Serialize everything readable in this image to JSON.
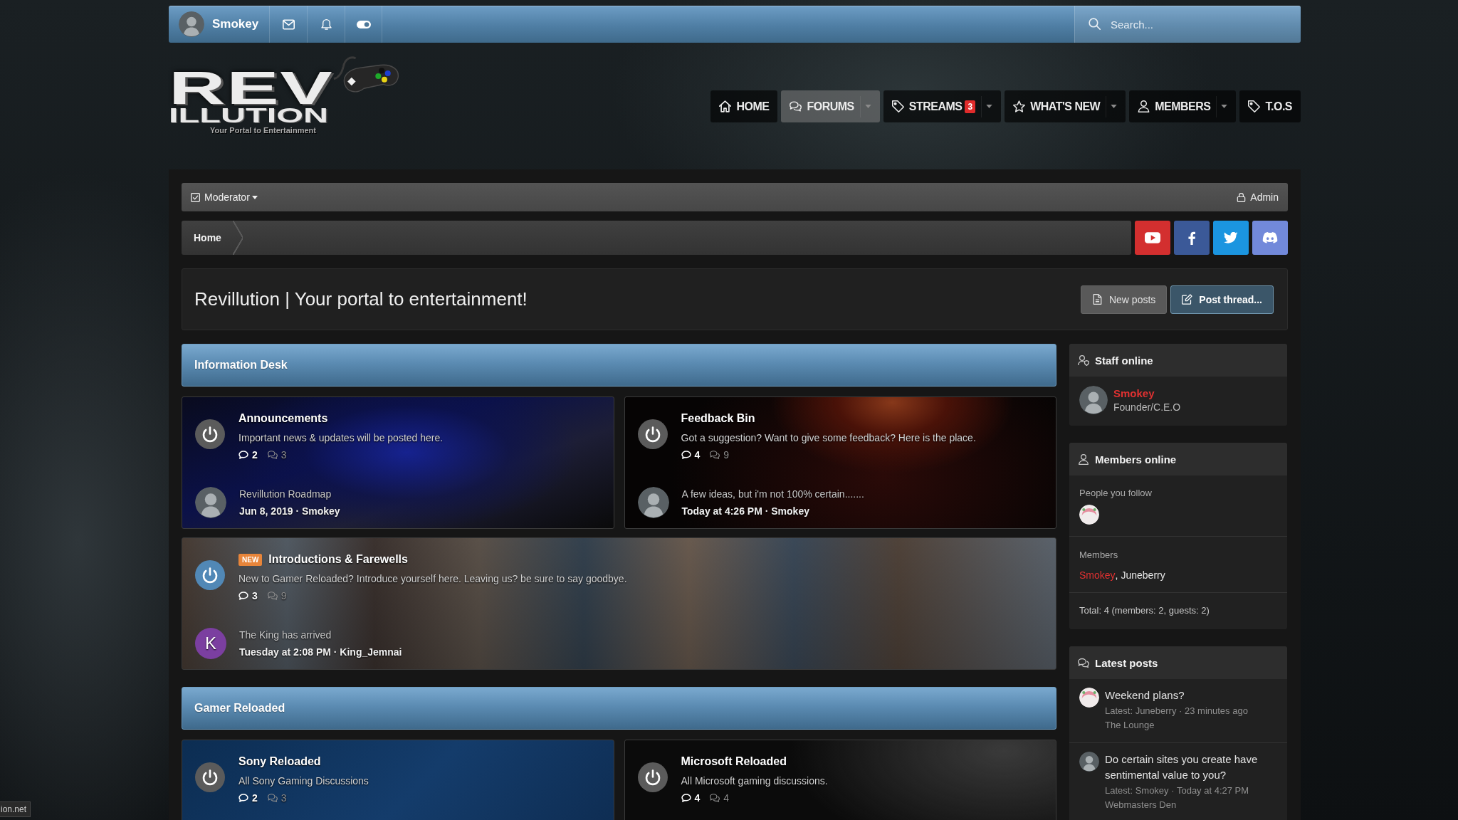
{
  "top_bar": {
    "username": "Smokey",
    "avatar": {
      "kind": "photo"
    },
    "search": {
      "placeholder": "Search..."
    }
  },
  "logo": {
    "line_1": "REV",
    "line_2": "ILLUTION",
    "tagline": "Your Portal to Entertainment"
  },
  "nav": [
    {
      "label": "HOME",
      "kind": "home",
      "selected": false,
      "dropdown": false
    },
    {
      "label": "FORUMS",
      "kind": "forums",
      "selected": true,
      "dropdown": true
    },
    {
      "label": "STREAMS",
      "kind": "streams",
      "selected": false,
      "dropdown": true,
      "badge": "3"
    },
    {
      "label": "WHAT'S NEW",
      "kind": "news",
      "selected": false,
      "dropdown": true
    },
    {
      "label": "MEMBERS",
      "kind": "members",
      "selected": false,
      "dropdown": true
    },
    {
      "label": "T.O.S",
      "kind": "rules",
      "selected": false,
      "dropdown": false
    }
  ],
  "moderator_bar": {
    "moderator_label": "Moderator",
    "admin_label": "Admin"
  },
  "breadcrumb": [
    "Home"
  ],
  "social_links": [
    {
      "kind": "youtube",
      "color": "#d32f2f"
    },
    {
      "kind": "facebook",
      "color": "#3b5998"
    },
    {
      "kind": "twitter",
      "color": "#1b95e0"
    },
    {
      "kind": "discord",
      "color": "#7289da"
    }
  ],
  "page_title": "Revillution | Your portal to entertainment!",
  "title_buttons": [
    {
      "label": "New posts",
      "kind": "feed"
    },
    {
      "label": "Post thread...",
      "kind": "compose"
    }
  ],
  "sections": [
    {
      "title": "Information Desk",
      "forums": [
        {
          "title": "Announcements",
          "kind": "news",
          "description": "Important news & updates will be posted here.",
          "threads": "2",
          "messages": "3",
          "unread": false,
          "latest": {
            "title": "Revillution Roadmap",
            "meta": "Jun 8, 2019 · Smokey",
            "avatar": {
              "kind": "photo"
            }
          }
        },
        {
          "title": "Feedback Bin",
          "kind": "brain",
          "description": "Got a suggestion? Want to give some feedback? Here is the place.",
          "threads": "4",
          "messages": "9",
          "unread": false,
          "latest": {
            "title": "A few ideas, but i'm not 100% certain.......",
            "meta": "Today at 4:26 PM · Smokey",
            "avatar": {
              "kind": "photo"
            }
          }
        },
        {
          "title": "Introductions & Farewells",
          "kind": "crowd",
          "badge": "NEW",
          "description": "New to Gamer Reloaded? Introduce yourself here. Leaving us? be sure to say goodbye.",
          "threads": "3",
          "messages": "9",
          "unread": true,
          "latest": {
            "title": "The King has arrived",
            "meta": "Tuesday at 2:08 PM · King_Jemnai",
            "avatar": {
              "kind": "letter",
              "letter": "K",
              "color": "#7b3fa0"
            }
          }
        }
      ]
    },
    {
      "title": "Gamer Reloaded",
      "forums": [
        {
          "title": "Sony Reloaded",
          "kind": "playstation",
          "description": "All Sony Gaming Discussions",
          "threads": "2",
          "messages": "3",
          "unread": false
        },
        {
          "title": "Microsoft Reloaded",
          "kind": "console",
          "description": "All Microsoft gaming discussions.",
          "threads": "4",
          "messages": "4",
          "unread": false
        }
      ]
    }
  ],
  "sidebar": {
    "staff_online": {
      "title": "Staff online",
      "members": [
        {
          "name": "Smokey",
          "role": "Founder/C.E.O",
          "color": "#e03131",
          "avatar": {
            "kind": "photo"
          }
        }
      ]
    },
    "members_online": {
      "title": "Members online",
      "following_label": "People you follow",
      "following": [
        {
          "avatar": {
            "kind": "cartoon"
          }
        }
      ],
      "members_label": "Members",
      "members": [
        {
          "name": "Smokey",
          "color": "#e03131",
          "separator": ","
        },
        {
          "name": "Juneberry",
          "color": "#e6e6e6"
        }
      ],
      "total": "Total: 4 (members: 2, guests: 2)"
    },
    "latest_posts": {
      "title": "Latest posts",
      "posts": [
        {
          "title": "Weekend plans?",
          "meta": "Latest: Juneberry · 23 minutes ago",
          "forum": "The Lounge",
          "avatar": {
            "kind": "cartoon"
          }
        },
        {
          "title": "Do certain sites you create have sentimental value to you?",
          "meta": "Latest: Smokey · Today at 4:27 PM",
          "forum": "Webmasters Den",
          "avatar": {
            "kind": "photo"
          }
        }
      ]
    }
  },
  "status_url": "ion.net"
}
